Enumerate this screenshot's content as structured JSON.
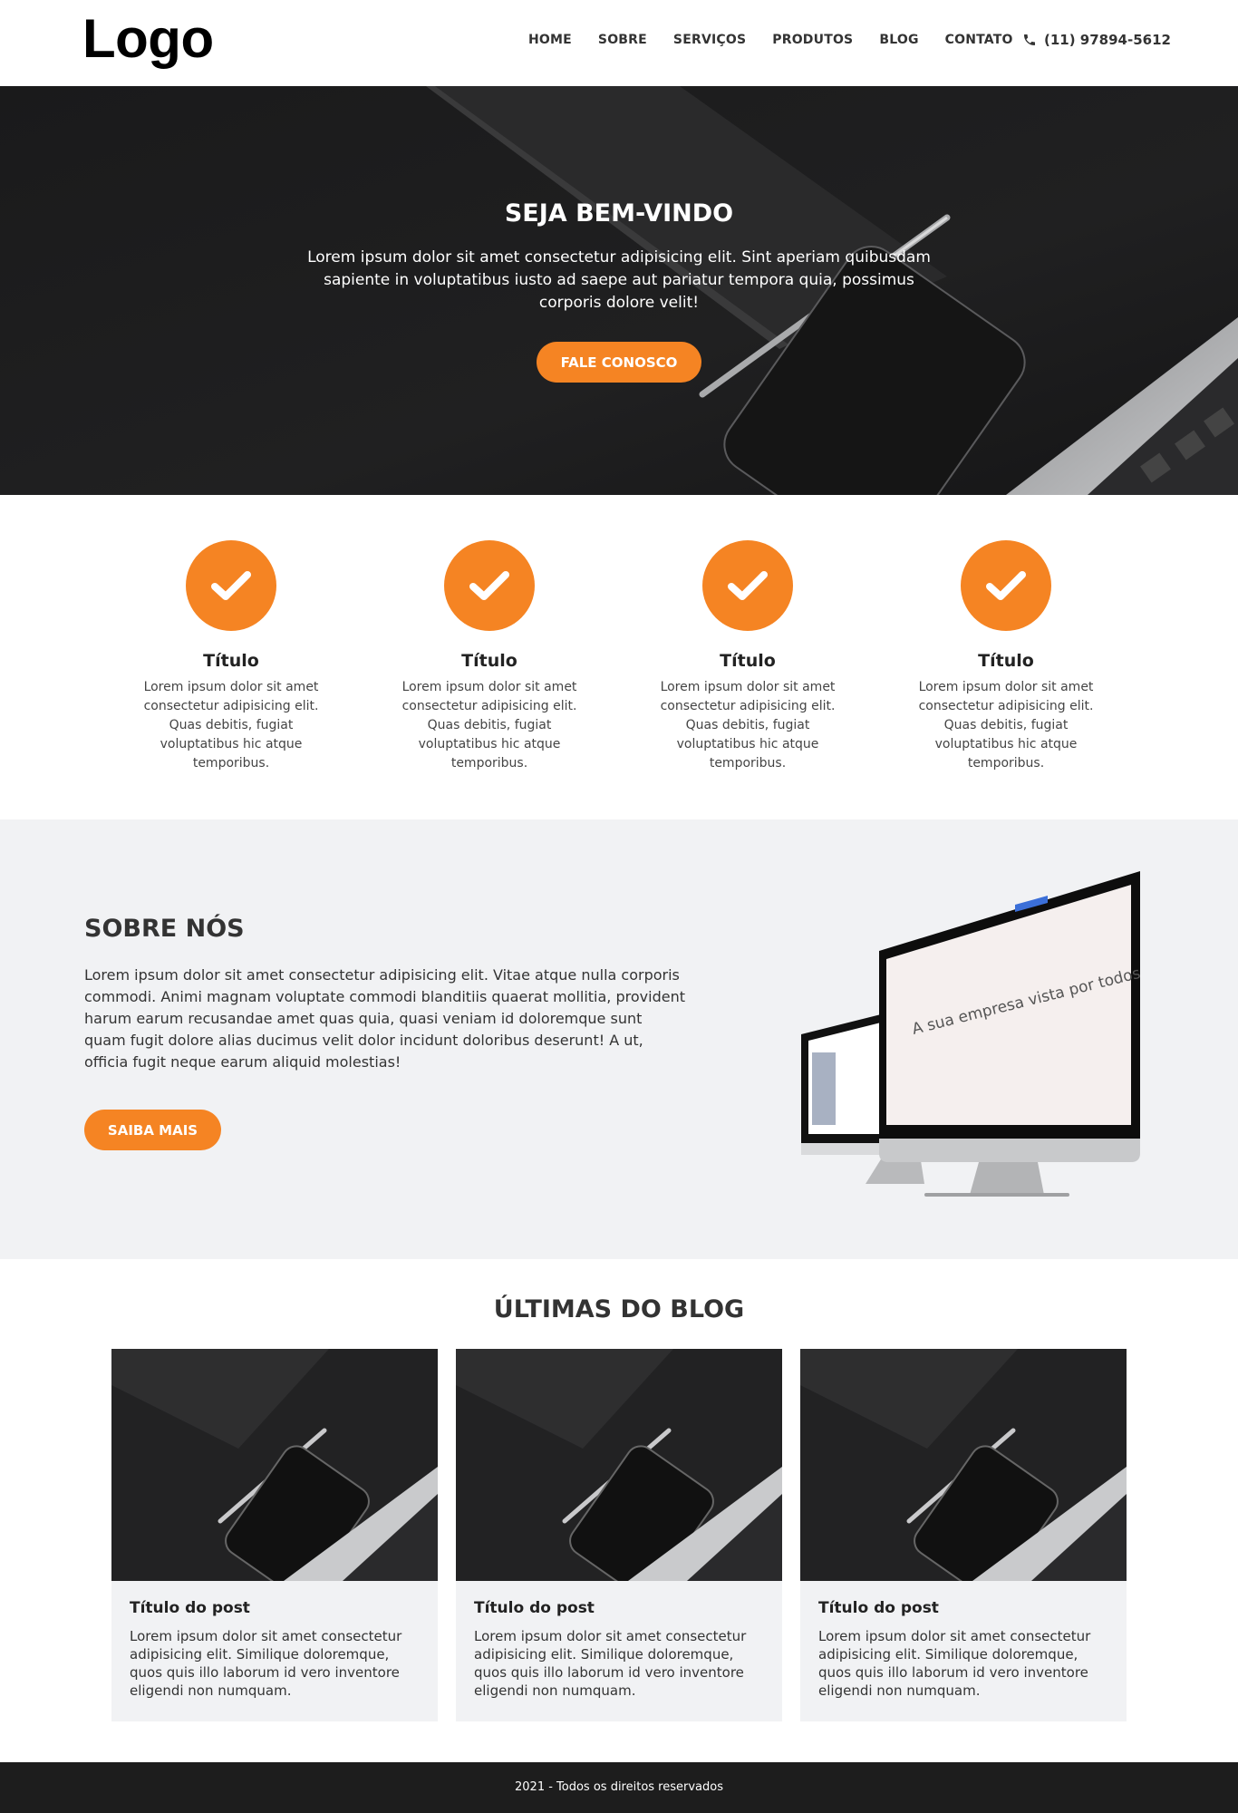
{
  "colors": {
    "accent": "#f58423",
    "dark": "#1b1b1c",
    "light_bg": "#f1f2f4"
  },
  "header": {
    "logo": "Logo",
    "nav": [
      "HOME",
      "SOBRE",
      "SERVIÇOS",
      "PRODUTOS",
      "BLOG",
      "CONTATO"
    ],
    "phone_icon": "phone-icon",
    "phone": "(11) 97894-5612"
  },
  "hero": {
    "title": "SEJA BEM-VINDO",
    "text": "Lorem ipsum dolor sit amet consectetur adipisicing elit. Sint aperiam quibusdam sapiente in voluptatibus iusto ad saepe aut pariatur tempora quia, possimus corporis dolore velit!",
    "button": "FALE CONOSCO"
  },
  "features": [
    {
      "icon": "check-icon",
      "title": "Título",
      "text": "Lorem ipsum dolor sit amet consectetur adipisicing elit. Quas debitis, fugiat voluptatibus hic atque temporibus."
    },
    {
      "icon": "check-icon",
      "title": "Título",
      "text": "Lorem ipsum dolor sit amet consectetur adipisicing elit. Quas debitis, fugiat voluptatibus hic atque temporibus."
    },
    {
      "icon": "check-icon",
      "title": "Título",
      "text": "Lorem ipsum dolor sit amet consectetur adipisicing elit. Quas debitis, fugiat voluptatibus hic atque temporibus."
    },
    {
      "icon": "check-icon",
      "title": "Título",
      "text": "Lorem ipsum dolor sit amet consectetur adipisicing elit. Quas debitis, fugiat voluptatibus hic atque temporibus."
    }
  ],
  "about": {
    "title": "SOBRE NÓS",
    "text": "Lorem ipsum dolor sit amet consectetur adipisicing elit. Vitae atque nulla corporis commodi. Animi magnam voluptate commodi blanditiis quaerat mollitia, provident harum earum recusandae amet quas quia, quasi veniam id doloremque sunt quam fugit dolore alias ducimus velit dolor incidunt doloribus deserunt! A ut, officia fugit neque earum aliquid molestias!",
    "button": "SAIBA MAIS",
    "screen_text": "A sua empresa vista por todos"
  },
  "blog": {
    "title": "ÚLTIMAS DO BLOG",
    "posts": [
      {
        "title": "Título do post",
        "text": "Lorem ipsum dolor sit amet consectetur adipisicing elit. Similique doloremque, quos quis illo laborum id vero inventore eligendi non numquam."
      },
      {
        "title": "Título do post",
        "text": "Lorem ipsum dolor sit amet consectetur adipisicing elit. Similique doloremque, quos quis illo laborum id vero inventore eligendi non numquam."
      },
      {
        "title": "Título do post",
        "text": "Lorem ipsum dolor sit amet consectetur adipisicing elit. Similique doloremque, quos quis illo laborum id vero inventore eligendi non numquam."
      }
    ]
  },
  "footer": {
    "text": "2021 - Todos os direitos reservados"
  }
}
